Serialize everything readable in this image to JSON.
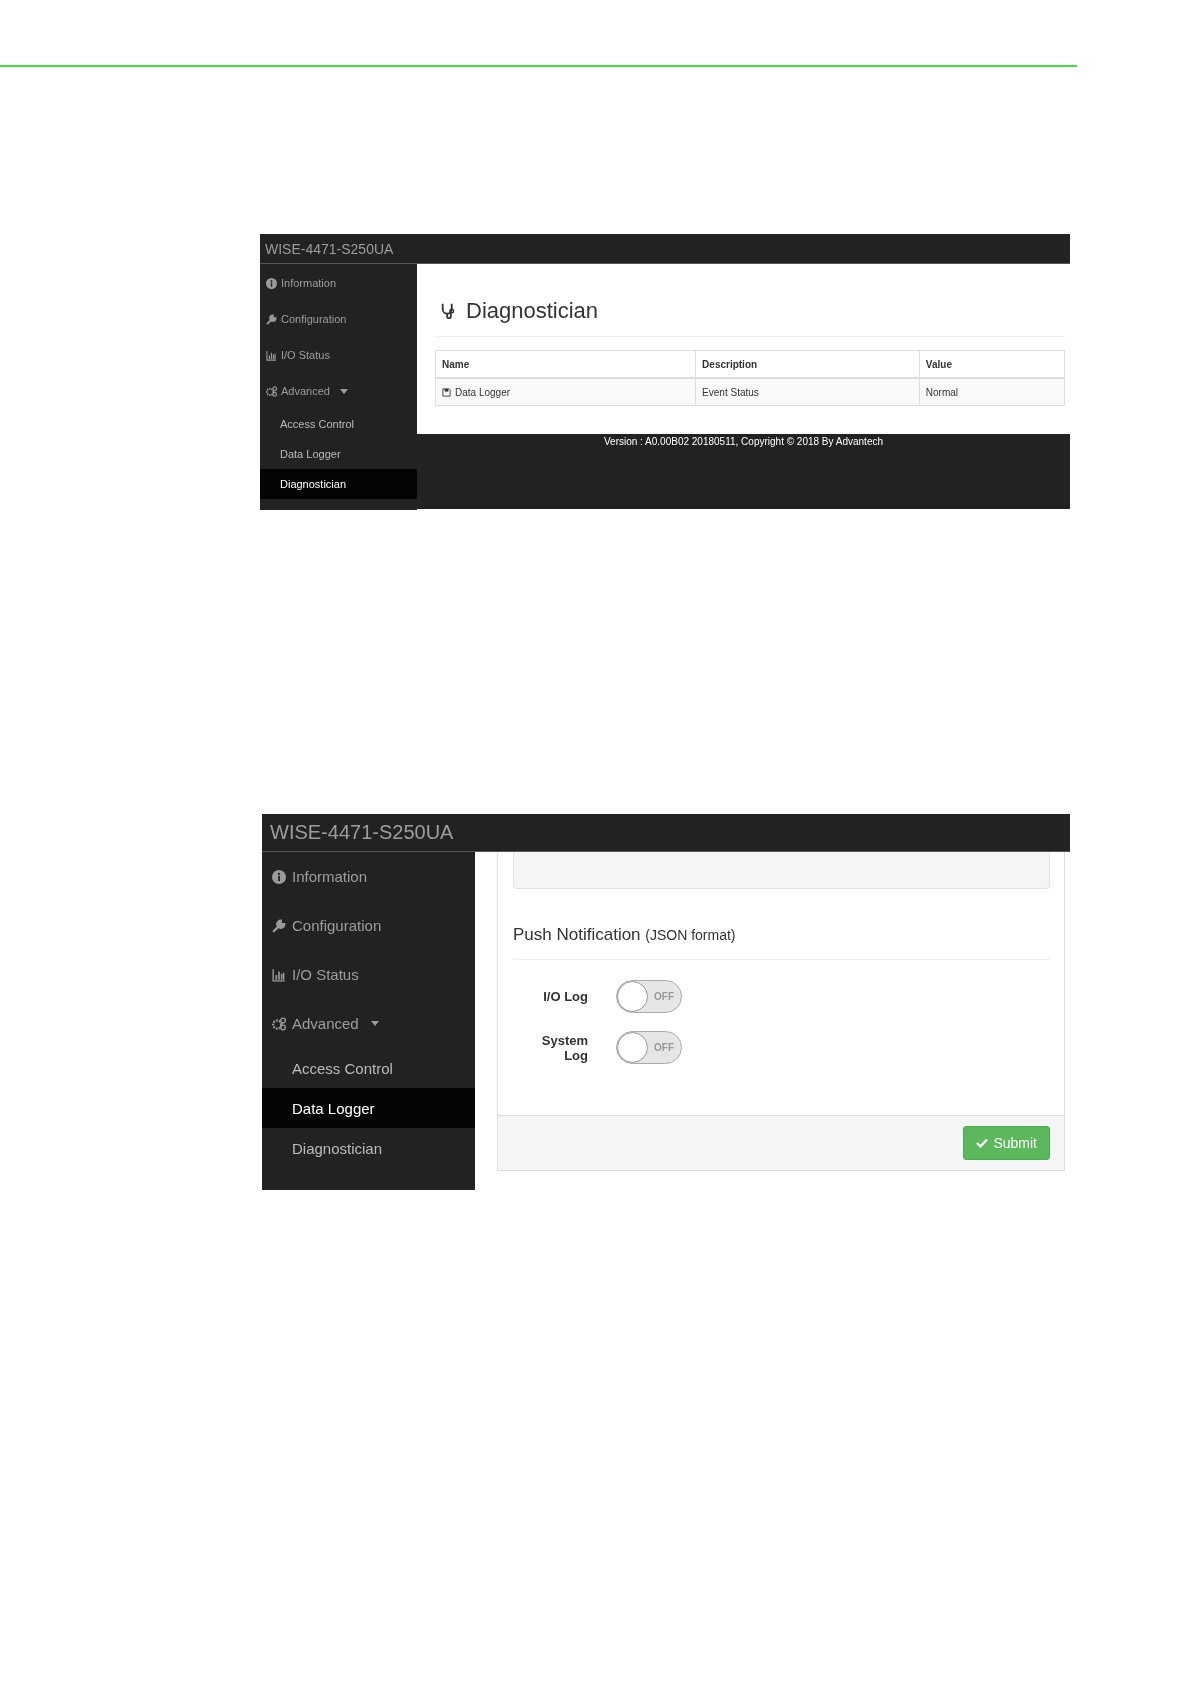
{
  "screenshot_1": {
    "title": "WISE-4471-S250UA",
    "sidebar": {
      "items": [
        {
          "label": "Information",
          "selected": false
        },
        {
          "label": "Configuration",
          "selected": false
        },
        {
          "label": "I/O Status",
          "selected": false
        },
        {
          "label": "Advanced",
          "selected": false,
          "expanded": true,
          "children": [
            {
              "label": "Access Control",
              "selected": false
            },
            {
              "label": "Data Logger",
              "selected": false
            },
            {
              "label": "Diagnostician",
              "selected": true
            }
          ]
        }
      ]
    },
    "heading": "Diagnostician",
    "table": {
      "columns": [
        "Name",
        "Description",
        "Value"
      ],
      "rows": [
        [
          "Data Logger",
          "Event Status",
          "Normal"
        ]
      ]
    },
    "footer": "Version : A0.00B02 20180511, Copyright © 2018 By Advantech"
  },
  "screenshot_2": {
    "title": "WISE-4471-S250UA",
    "sidebar": {
      "items": [
        {
          "label": "Information",
          "selected": false
        },
        {
          "label": "Configuration",
          "selected": false
        },
        {
          "label": "I/O Status",
          "selected": false
        },
        {
          "label": "Advanced",
          "selected": false,
          "expanded": true,
          "children": [
            {
              "label": "Access Control",
              "selected": false
            },
            {
              "label": "Data Logger",
              "selected": true
            },
            {
              "label": "Diagnostician",
              "selected": false
            }
          ]
        }
      ]
    },
    "section_title": "Push Notification",
    "section_note": "(JSON format)",
    "toggles": [
      {
        "label": "I/O Log",
        "on": false,
        "state_text": "OFF"
      },
      {
        "label": "System Log",
        "on": false,
        "state_text": "OFF"
      }
    ],
    "submit": "Submit"
  }
}
